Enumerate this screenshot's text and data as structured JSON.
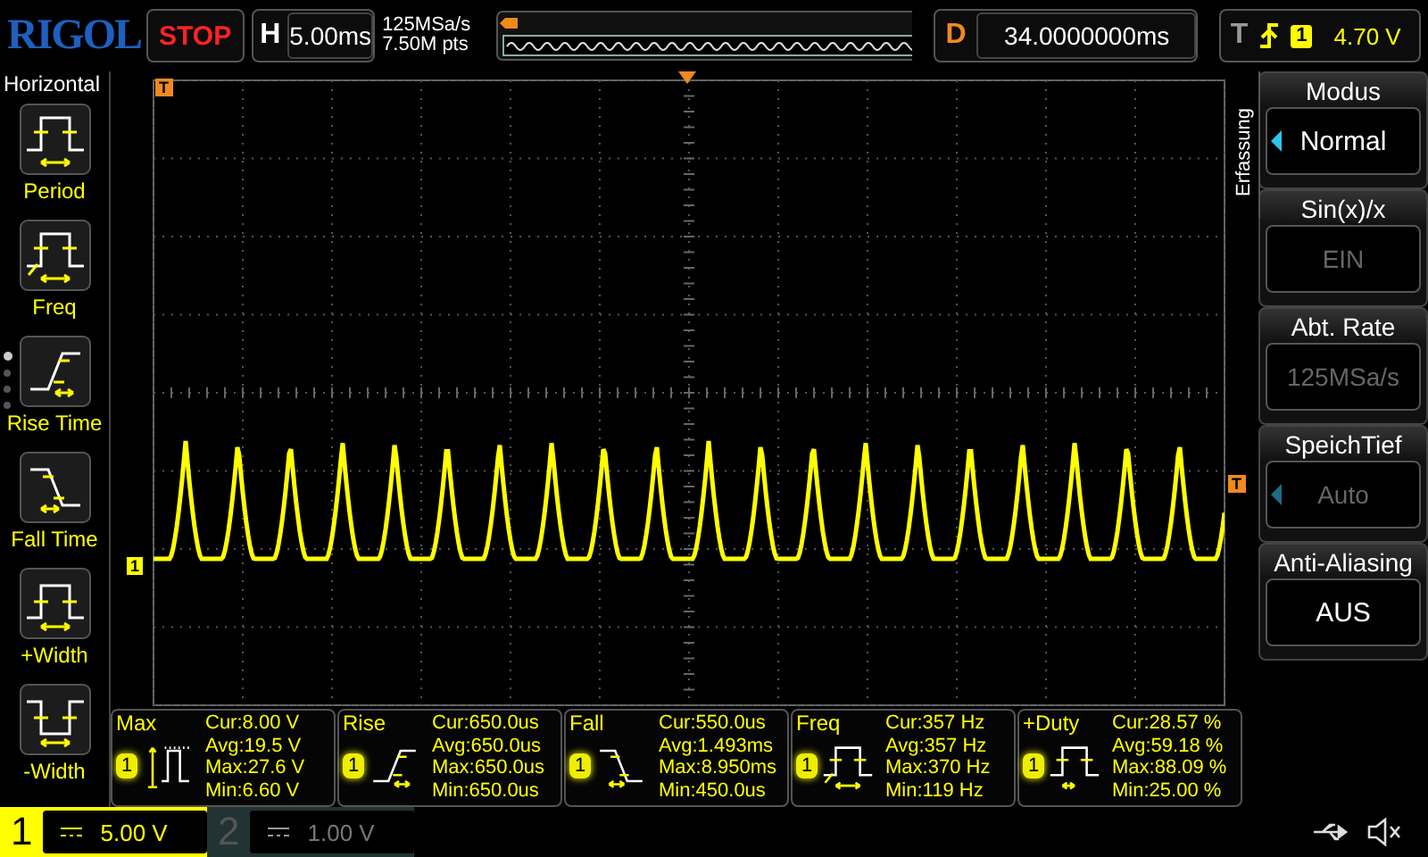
{
  "brand": "RIGOL",
  "run_state": {
    "label": "STOP",
    "kind": "stop"
  },
  "timebase": {
    "label": "H",
    "value": "5.00ms"
  },
  "acquisition": {
    "sample_rate": "125MSa/s",
    "memory_depth": "7.50M pts"
  },
  "delay": {
    "label": "D",
    "value": "34.0000000ms"
  },
  "trigger": {
    "label": "T",
    "channel": "1",
    "voltage": "4.70 V"
  },
  "left_menu": {
    "title": "Horizontal",
    "pages": [
      {
        "selected": true
      },
      {
        "selected": false
      },
      {
        "selected": false
      },
      {
        "selected": false
      }
    ],
    "items": [
      {
        "label": "Period",
        "kind": "period"
      },
      {
        "label": "Freq",
        "kind": "freq"
      },
      {
        "label": "Rise Time",
        "kind": "rise"
      },
      {
        "label": "Fall Time",
        "kind": "fall"
      },
      {
        "label": "+Width",
        "kind": "pwidth"
      },
      {
        "label": "-Width",
        "kind": "nwidth"
      }
    ]
  },
  "markers": {
    "trigger_position": "T",
    "trigger_level": "T",
    "channel": "1"
  },
  "right_menu": {
    "title": "Erfassung",
    "items": [
      {
        "label": "Modus",
        "value": "Normal",
        "disabled": false,
        "kind": "select"
      },
      {
        "label": "Sin(x)/x",
        "value": "EIN",
        "disabled": true,
        "kind": "toggle"
      },
      {
        "label": "Abt. Rate",
        "value": "125MSa/s",
        "disabled": true,
        "kind": "toggle"
      },
      {
        "label": "SpeichTief",
        "value": "Auto",
        "disabled": true,
        "kind": "select"
      },
      {
        "label": "Anti-Aliasing",
        "value": "AUS",
        "disabled": false,
        "kind": "toggle"
      }
    ]
  },
  "measurements": [
    {
      "name": "Max",
      "channel": "1",
      "kind": "max",
      "lines": [
        "Cur:8.00 V",
        "Avg:19.5 V",
        "Max:27.6 V",
        "Min:6.60 V"
      ]
    },
    {
      "name": "Rise",
      "channel": "1",
      "kind": "rise",
      "lines": [
        "Cur:650.0us",
        "Avg:650.0us",
        "Max:650.0us",
        "Min:650.0us"
      ]
    },
    {
      "name": "Fall",
      "channel": "1",
      "kind": "fall",
      "lines": [
        "Cur:550.0us",
        "Avg:1.493ms",
        "Max:8.950ms",
        "Min:450.0us"
      ]
    },
    {
      "name": "Freq",
      "channel": "1",
      "kind": "freq",
      "lines": [
        "Cur:357 Hz",
        "Avg:357 Hz",
        "Max:370 Hz",
        "Min:119 Hz"
      ]
    },
    {
      "name": "+Duty",
      "channel": "1",
      "kind": "duty",
      "lines": [
        "Cur:28.57 %",
        "Avg:59.18 %",
        "Max:88.09 %",
        "Min:25.00 %"
      ]
    }
  ],
  "channels": [
    {
      "number": "1",
      "scale": "5.00 V",
      "on": true
    },
    {
      "number": "2",
      "scale": "1.00 V",
      "on": false
    }
  ]
}
